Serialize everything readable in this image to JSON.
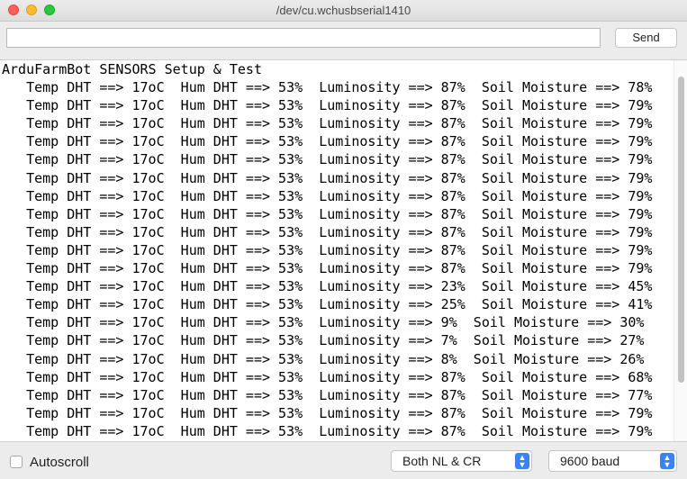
{
  "window": {
    "title": "/dev/cu.wchusbserial1410"
  },
  "send_bar": {
    "input_value": "",
    "input_placeholder": "",
    "send_label": "Send"
  },
  "console": {
    "lines": [
      "ArduFarmBot SENSORS Setup & Test",
      "   Temp DHT ==> 17oC  Hum DHT ==> 53%  Luminosity ==> 87%  Soil Moisture ==> 78%",
      "   Temp DHT ==> 17oC  Hum DHT ==> 53%  Luminosity ==> 87%  Soil Moisture ==> 79%",
      "   Temp DHT ==> 17oC  Hum DHT ==> 53%  Luminosity ==> 87%  Soil Moisture ==> 79%",
      "   Temp DHT ==> 17oC  Hum DHT ==> 53%  Luminosity ==> 87%  Soil Moisture ==> 79%",
      "   Temp DHT ==> 17oC  Hum DHT ==> 53%  Luminosity ==> 87%  Soil Moisture ==> 79%",
      "   Temp DHT ==> 17oC  Hum DHT ==> 53%  Luminosity ==> 87%  Soil Moisture ==> 79%",
      "   Temp DHT ==> 17oC  Hum DHT ==> 53%  Luminosity ==> 87%  Soil Moisture ==> 79%",
      "   Temp DHT ==> 17oC  Hum DHT ==> 53%  Luminosity ==> 87%  Soil Moisture ==> 79%",
      "   Temp DHT ==> 17oC  Hum DHT ==> 53%  Luminosity ==> 87%  Soil Moisture ==> 79%",
      "   Temp DHT ==> 17oC  Hum DHT ==> 53%  Luminosity ==> 87%  Soil Moisture ==> 79%",
      "   Temp DHT ==> 17oC  Hum DHT ==> 53%  Luminosity ==> 87%  Soil Moisture ==> 79%",
      "   Temp DHT ==> 17oC  Hum DHT ==> 53%  Luminosity ==> 23%  Soil Moisture ==> 45%",
      "   Temp DHT ==> 17oC  Hum DHT ==> 53%  Luminosity ==> 25%  Soil Moisture ==> 41%",
      "   Temp DHT ==> 17oC  Hum DHT ==> 53%  Luminosity ==> 9%  Soil Moisture ==> 30%",
      "   Temp DHT ==> 17oC  Hum DHT ==> 53%  Luminosity ==> 7%  Soil Moisture ==> 27%",
      "   Temp DHT ==> 17oC  Hum DHT ==> 53%  Luminosity ==> 8%  Soil Moisture ==> 26%",
      "   Temp DHT ==> 17oC  Hum DHT ==> 53%  Luminosity ==> 87%  Soil Moisture ==> 68%",
      "   Temp DHT ==> 17oC  Hum DHT ==> 53%  Luminosity ==> 87%  Soil Moisture ==> 77%",
      "   Temp DHT ==> 17oC  Hum DHT ==> 53%  Luminosity ==> 87%  Soil Moisture ==> 79%",
      "   Temp DHT ==> 17oC  Hum DHT ==> 53%  Luminosity ==> 87%  Soil Moisture ==> 79%"
    ]
  },
  "footer": {
    "autoscroll_label": "Autoscroll",
    "autoscroll_checked": false,
    "line_ending_selected": "Both NL & CR",
    "baud_selected": "9600 baud"
  },
  "icons": {
    "close": "close-dot",
    "minimize": "minimize-dot",
    "maximize": "maximize-dot",
    "select_arrows": "up-down-chevron-icon"
  },
  "colors": {
    "close": "#fc5f57",
    "minimize": "#fdbc2e",
    "maximize": "#28c840",
    "select_accent": "#3b82f6"
  }
}
